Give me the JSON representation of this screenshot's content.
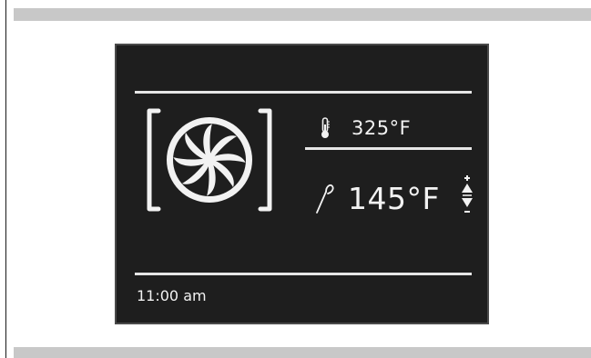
{
  "display": {
    "mode_icon": "convection-fan-icon",
    "oven_temperature": "325°F",
    "oven_temperature_icon": "thermometer-icon",
    "probe_temperature": "145°F",
    "probe_icon": "meat-probe-icon",
    "adjust_icon": "up-down-arrows-icon",
    "clock": "11:00 am"
  },
  "colors": {
    "screen_background": "#1e1e1e",
    "screen_foreground": "#f2f2f2",
    "page_bars": "#c8c8c8"
  }
}
